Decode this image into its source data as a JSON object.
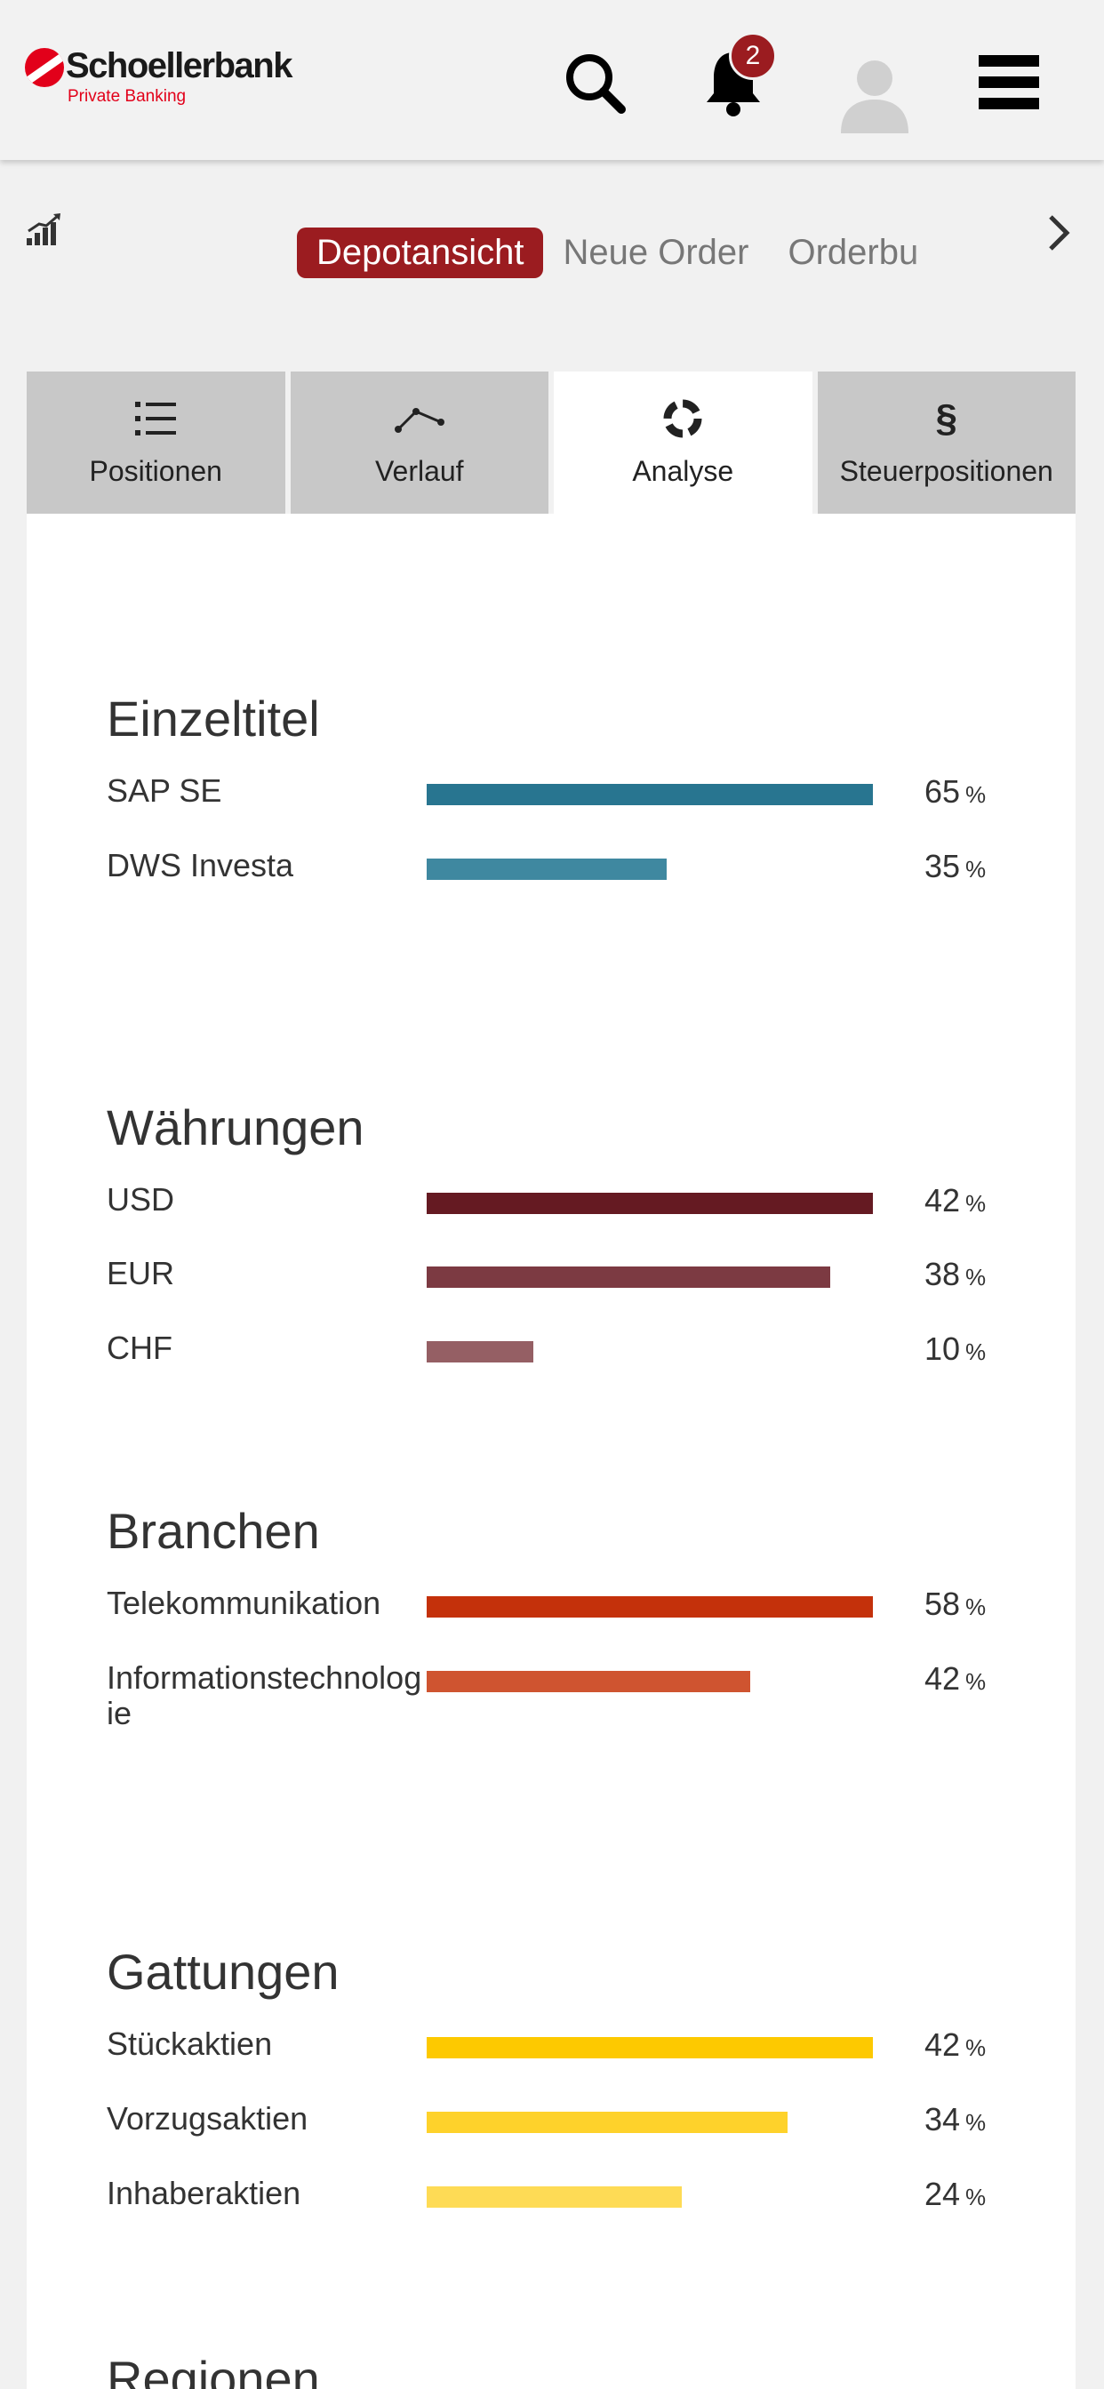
{
  "header": {
    "logo_name": "Schoellerbank",
    "logo_sub": "Private Banking",
    "notification_count": "2"
  },
  "nav": {
    "tabs": [
      {
        "label": "Depotansicht",
        "active": true
      },
      {
        "label": "Neue Order",
        "active": false
      },
      {
        "label": "Orderbu",
        "active": false
      }
    ]
  },
  "subtabs": [
    {
      "label": "Positionen",
      "icon": "list-icon",
      "active": false
    },
    {
      "label": "Verlauf",
      "icon": "line-graph-icon",
      "active": false
    },
    {
      "label": "Analyse",
      "icon": "donut-chart-icon",
      "active": true
    },
    {
      "label": "Steuerpositionen",
      "icon": "paragraph-icon",
      "active": false
    }
  ],
  "sections": [
    {
      "title": "Einzeltitel",
      "rows": [
        {
          "label": "SAP SE",
          "value": 65,
          "display": "65",
          "color": "#287590"
        },
        {
          "label": "DWS Investa",
          "value": 35,
          "display": "35",
          "color": "#3f88a0"
        }
      ]
    },
    {
      "title": "Währungen",
      "rows": [
        {
          "label": "USD",
          "value": 42,
          "display": "42",
          "color": "#651a22"
        },
        {
          "label": "EUR",
          "value": 38,
          "display": "38",
          "color": "#7c3a42"
        },
        {
          "label": "CHF",
          "value": 10,
          "display": "10",
          "color": "#955f64"
        }
      ]
    },
    {
      "title": "Branchen",
      "rows": [
        {
          "label": "Telekommunikation",
          "value": 58,
          "display": "58",
          "color": "#c4310b"
        },
        {
          "label": "Informationstechnologie",
          "value": 42,
          "display": "42",
          "color": "#cf5430"
        }
      ]
    },
    {
      "title": "Gattungen",
      "rows": [
        {
          "label": "Stückaktien",
          "value": 42,
          "display": "42",
          "color": "#fdc900"
        },
        {
          "label": "Vorzugsaktien",
          "value": 34,
          "display": "34",
          "color": "#fed22b"
        },
        {
          "label": "Inhaberaktien",
          "value": 24,
          "display": "24",
          "color": "#fedb55"
        }
      ]
    },
    {
      "title": "Regionen",
      "rows": []
    }
  ],
  "percent_sign": "%",
  "colors": {
    "brand_red": "#9b1c20",
    "logo_red": "#e2001a"
  }
}
